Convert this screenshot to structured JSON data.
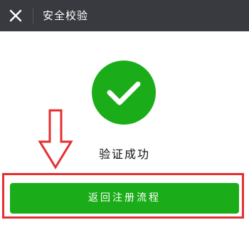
{
  "header": {
    "title": "安全校验",
    "close_icon": "close-icon"
  },
  "main": {
    "success_icon": "checkmark-circle-icon",
    "status_text": "验证成功",
    "return_button_label": "返回注册流程"
  },
  "colors": {
    "header_bg": "#393a3f",
    "success_green": "#1aad19",
    "annotation_red": "#e52f33"
  }
}
